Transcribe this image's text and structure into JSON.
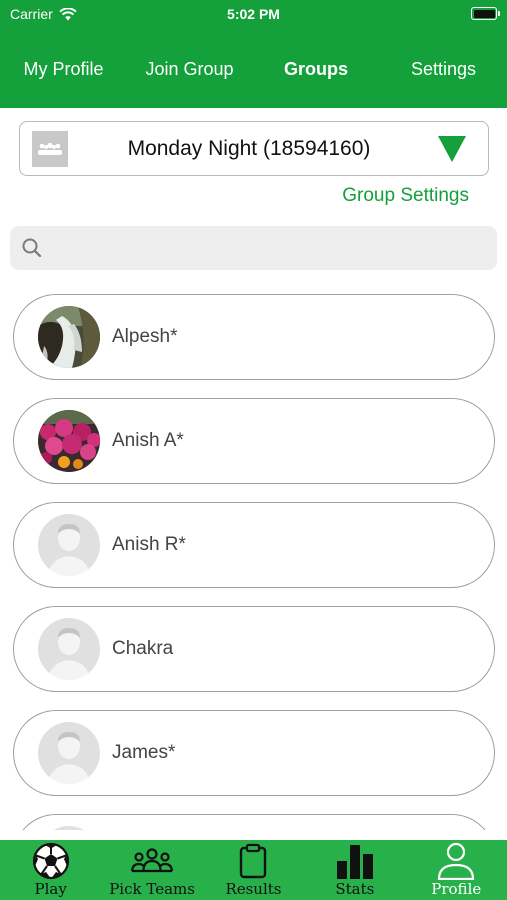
{
  "status_bar": {
    "carrier": "Carrier",
    "time": "5:02 PM"
  },
  "top_nav": {
    "tabs": [
      {
        "label": "My Profile",
        "active": false
      },
      {
        "label": "Join Group",
        "active": false
      },
      {
        "label": "Groups",
        "active": true
      },
      {
        "label": "Settings",
        "active": false
      }
    ]
  },
  "group_selector": {
    "name": "Monday Night (18594160)",
    "icon": "group-icon",
    "dropdown_icon": "triangle-down-icon"
  },
  "group_settings_label": "Group Settings",
  "search": {
    "placeholder": "",
    "value": "",
    "icon": "search-icon"
  },
  "members": [
    {
      "name": "Alpesh*",
      "avatar": "waterfall-photo"
    },
    {
      "name": "Anish A*",
      "avatar": "flowers-photo"
    },
    {
      "name": "Anish R*",
      "avatar": "default-person"
    },
    {
      "name": "Chakra",
      "avatar": "default-person"
    },
    {
      "name": "James*",
      "avatar": "default-person"
    },
    {
      "name": "",
      "avatar": "default-person"
    }
  ],
  "bottom_tabs": [
    {
      "label": "Play",
      "icon": "soccer-ball-icon",
      "active": false
    },
    {
      "label": "Pick Teams",
      "icon": "people-group-icon",
      "active": false
    },
    {
      "label": "Results",
      "icon": "clipboard-icon",
      "active": false
    },
    {
      "label": "Stats",
      "icon": "bar-chart-icon",
      "active": false
    },
    {
      "label": "Profile",
      "icon": "person-icon",
      "active": true
    }
  ],
  "colors": {
    "brand_green": "#14a03a",
    "tabbar_green": "#28b04b",
    "active_tab_text": "#ffffff"
  }
}
